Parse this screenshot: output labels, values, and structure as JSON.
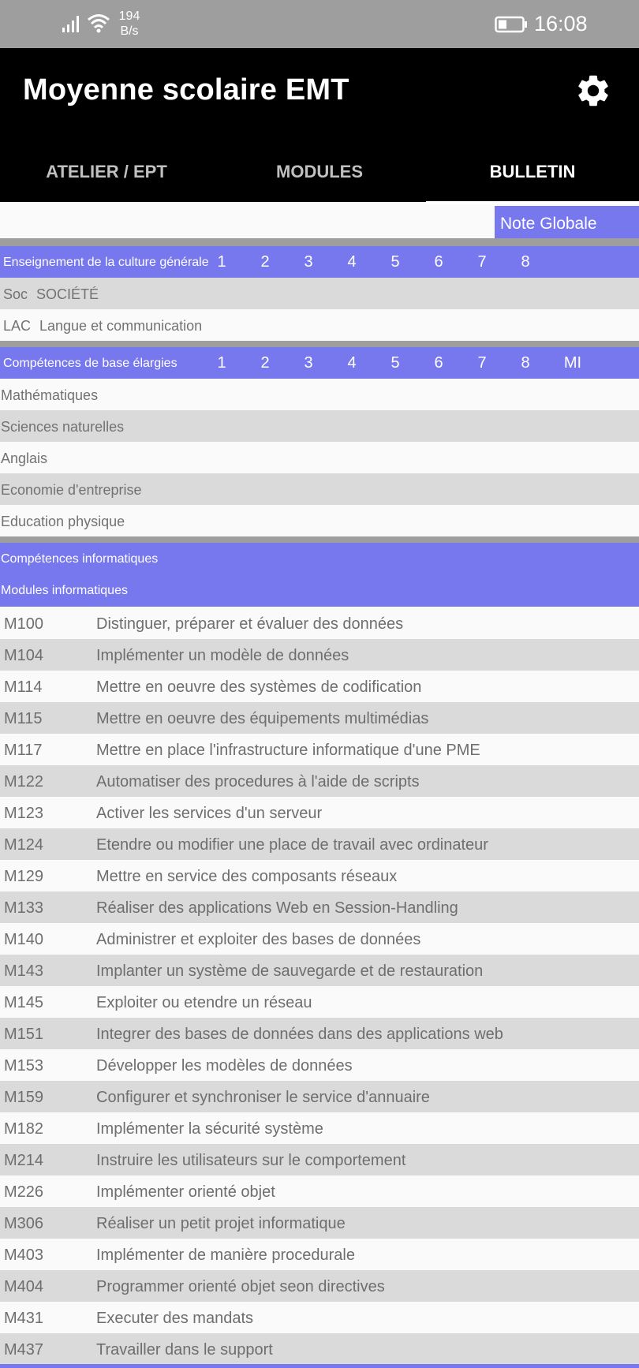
{
  "status_bar": {
    "speed_value": "194",
    "speed_unit": "B/s",
    "time": "16:08",
    "icons": [
      "signal-icon",
      "wifi-icon",
      "battery-icon"
    ]
  },
  "app": {
    "title": "Moyenne scolaire EMT",
    "settings_icon": "gear-icon"
  },
  "tabs": [
    {
      "label": "ATELIER / EPT",
      "active": false
    },
    {
      "label": "MODULES",
      "active": false
    },
    {
      "label": "BULLETIN",
      "active": true
    }
  ],
  "note_globale": "Note Globale",
  "culture_generale": {
    "title": "Enseignement de la culture générale",
    "columns": [
      "1",
      "2",
      "3",
      "4",
      "5",
      "6",
      "7",
      "8"
    ],
    "rows": [
      {
        "abbr": "Soc",
        "name": "SOCIÉTÉ"
      },
      {
        "abbr": "LAC",
        "name": "Langue et communication"
      }
    ]
  },
  "competences_base": {
    "title": "Compétences de base élargies",
    "columns": [
      "1",
      "2",
      "3",
      "4",
      "5",
      "6",
      "7",
      "8",
      "MI"
    ],
    "rows": [
      "Mathématiques",
      "Sciences naturelles",
      "Anglais",
      "Economie d'entreprise",
      "Education physique"
    ]
  },
  "competences_info": {
    "title": "Compétences informatiques",
    "subtitle": "Modules informatiques",
    "modules": [
      {
        "code": "M100",
        "name": "Distinguer, préparer et évaluer des données"
      },
      {
        "code": "M104",
        "name": "Implémenter un modèle de données"
      },
      {
        "code": "M114",
        "name": "Mettre en oeuvre des systèmes de codification"
      },
      {
        "code": "M115",
        "name": "Mettre en oeuvre des équipements multimédias"
      },
      {
        "code": "M117",
        "name": "Mettre en place l'infrastructure informatique d'une PME"
      },
      {
        "code": "M122",
        "name": "Automatiser des procedures à l'aide de scripts"
      },
      {
        "code": "M123",
        "name": "Activer les services d'un serveur"
      },
      {
        "code": "M124",
        "name": "Etendre ou modifier une place de travail avec ordinateur"
      },
      {
        "code": "M129",
        "name": "Mettre en service des composants réseaux"
      },
      {
        "code": "M133",
        "name": "Réaliser des applications Web en Session-Handling"
      },
      {
        "code": "M140",
        "name": "Administrer et exploiter des bases de données"
      },
      {
        "code": "M143",
        "name": "Implanter un système de sauvegarde et de restauration"
      },
      {
        "code": "M145",
        "name": "Exploiter ou etendre un réseau"
      },
      {
        "code": "M151",
        "name": "Integrer des bases de données dans des applications web"
      },
      {
        "code": "M153",
        "name": "Développer les modèles de données"
      },
      {
        "code": "M159",
        "name": "Configurer et synchroniser le service d'annuaire"
      },
      {
        "code": "M182",
        "name": "Implémenter la sécurité système"
      },
      {
        "code": "M214",
        "name": "Instruire les utilisateurs sur le comportement"
      },
      {
        "code": "M226",
        "name": "Implémenter orienté objet"
      },
      {
        "code": "M306",
        "name": "Réaliser un petit projet informatique"
      },
      {
        "code": "M403",
        "name": "Implémenter de manière procedurale"
      },
      {
        "code": "M404",
        "name": "Programmer orienté objet seon directives"
      },
      {
        "code": "M431",
        "name": "Executer des mandats"
      },
      {
        "code": "M437",
        "name": "Travailler dans le support"
      }
    ]
  },
  "colors": {
    "accent": "#7777ee",
    "app_bar": "#000000",
    "status_bar": "#9e9e9e",
    "row_alt": "#dadada",
    "row_plain": "#fafafa"
  }
}
